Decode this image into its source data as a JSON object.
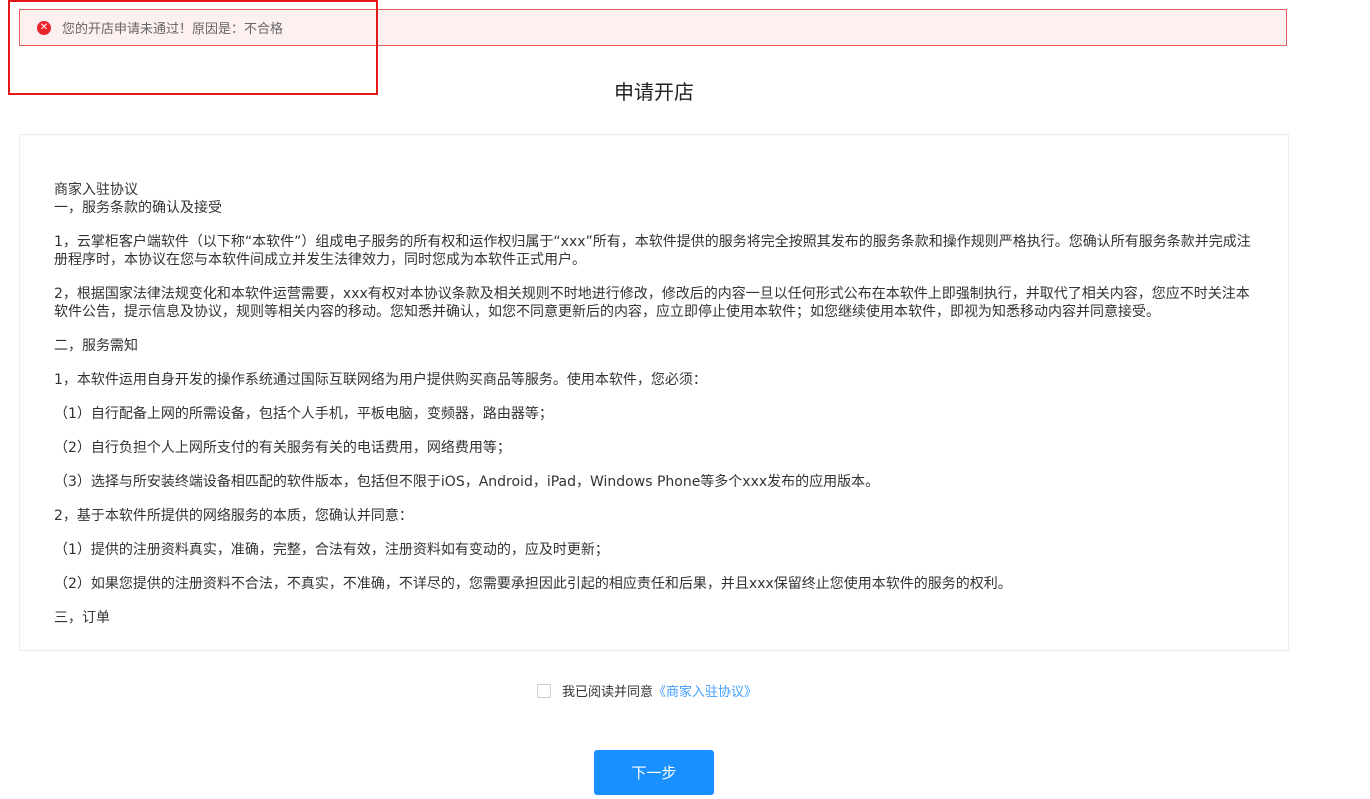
{
  "alert": {
    "icon": "error-circle-icon",
    "color": "#e8242c",
    "message": "您的开店申请未通过！原因是：不合格"
  },
  "title": "申请开店",
  "agreement": {
    "heading": "商家入驻协议",
    "sections": [
      {
        "text": "一，服务条款的确认及接受",
        "tight": true
      },
      {
        "text": "1，云掌柜客户端软件（以下称“本软件”）组成电子服务的所有权和运作权归属于“xxx”所有，本软件提供的服务将完全按照其发布的服务条款和操作规则严格执行。您确认所有服务条款并完成注册程序时，本协议在您与本软件间成立并发生法律效力，同时您成为本软件正式用户。"
      },
      {
        "text": "2，根据国家法律法规变化和本软件运营需要，xxx有权对本协议条款及相关规则不时地进行修改，修改后的内容一旦以任何形式公布在本软件上即强制执行，并取代了相关内容，您应不时关注本软件公告，提示信息及协议，规则等相关内容的移动。您知悉并确认，如您不同意更新后的内容，应立即停止使用本软件；如您继续使用本软件，即视为知悉移动内容并同意接受。"
      },
      {
        "text": "二，服务需知"
      },
      {
        "text": "1，本软件运用自身开发的操作系统通过国际互联网络为用户提供购买商品等服务。使用本软件，您必须："
      },
      {
        "text": "（1）自行配备上网的所需设备，包括个人手机，平板电脑，变频器，路由器等；"
      },
      {
        "text": "（2）自行负担个人上网所支付的有关服务有关的电话费用，网络费用等；"
      },
      {
        "text": "（3）选择与所安装终端设备相匹配的软件版本，包括但不限于iOS，Android，iPad，Windows Phone等多个xxx发布的应用版本。"
      },
      {
        "text": "2，基于本软件所提供的网络服务的本质，您确认并同意："
      },
      {
        "text": "（1）提供的注册资料真实，准确，完整，合法有效，注册资料如有变动的，应及时更新；"
      },
      {
        "text": "（2）如果您提供的注册资料不合法，不真实，不准确，不详尽的，您需要承担因此引起的相应责任和后果，并且xxx保留终止您使用本软件的服务的权利。"
      },
      {
        "text": "三，订单"
      }
    ]
  },
  "agree": {
    "label": "我已阅读并同意",
    "link": "《商家入驻协议》",
    "checked": false
  },
  "next_button": "下一步",
  "colors": {
    "primary": "#1a8fff",
    "link": "#409eff",
    "alert_bg": "#fdf0f0",
    "alert_border": "#e06060"
  }
}
